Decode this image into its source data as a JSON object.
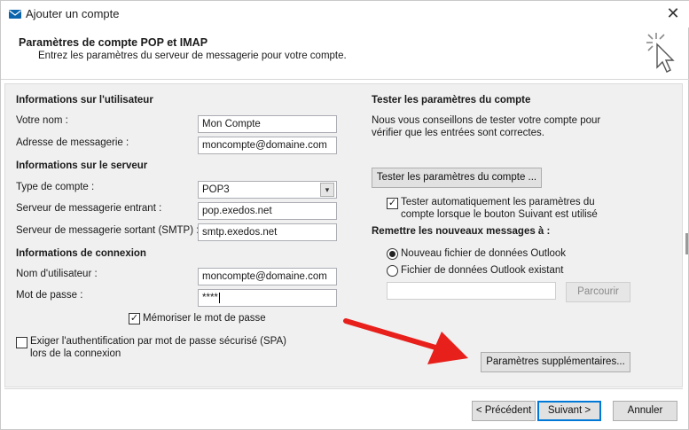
{
  "window": {
    "title": "Ajouter un compte",
    "close_glyph": "✕"
  },
  "header": {
    "title": "Paramètres de compte POP et IMAP",
    "subtitle": "Entrez les paramètres du serveur de messagerie pour votre compte."
  },
  "user_info": {
    "section": "Informations sur l'utilisateur",
    "name_label": "Votre nom :",
    "name_value": "Mon Compte",
    "email_label": "Adresse de messagerie :",
    "email_value": "moncompte@domaine.com"
  },
  "server_info": {
    "section": "Informations sur le serveur",
    "account_type_label": "Type de compte :",
    "account_type_value": "POP3",
    "incoming_label": "Serveur de messagerie entrant :",
    "incoming_value": "pop.exedos.net",
    "outgoing_label": "Serveur de messagerie sortant (SMTP) :",
    "outgoing_value": "smtp.exedos.net"
  },
  "login_info": {
    "section": "Informations de connexion",
    "username_label": "Nom d'utilisateur :",
    "username_value": "moncompte@domaine.com",
    "password_label": "Mot de passe :",
    "password_value": "****",
    "remember_label": "Mémoriser le mot de passe",
    "remember_checked": true,
    "spa_label_line1": "Exiger l'authentification par mot de passe sécurisé (SPA)",
    "spa_label_line2": "lors de la connexion",
    "spa_checked": false
  },
  "test": {
    "section": "Tester les paramètres du compte",
    "description_line1": "Nous vous conseillons de tester votre compte pour",
    "description_line2": "vérifier que les entrées sont correctes.",
    "test_button": "Tester les paramètres du compte ...",
    "auto_test_line1": "Tester automatiquement les paramètres du",
    "auto_test_line2": "compte lorsque le bouton Suivant est utilisé",
    "auto_test_checked": true
  },
  "deliver": {
    "section": "Remettre les nouveaux messages à :",
    "option_new": "Nouveau fichier de données Outlook",
    "option_existing": "Fichier de données Outlook existant",
    "selected": "new",
    "path_value": "",
    "browse_button": "Parcourir"
  },
  "more_settings_button": "Paramètres supplémentaires...",
  "footer": {
    "back": "< Précédent",
    "next": "Suivant >",
    "cancel": "Annuler"
  },
  "colors": {
    "arrow": "#e8201c",
    "accent": "#0078d7"
  }
}
